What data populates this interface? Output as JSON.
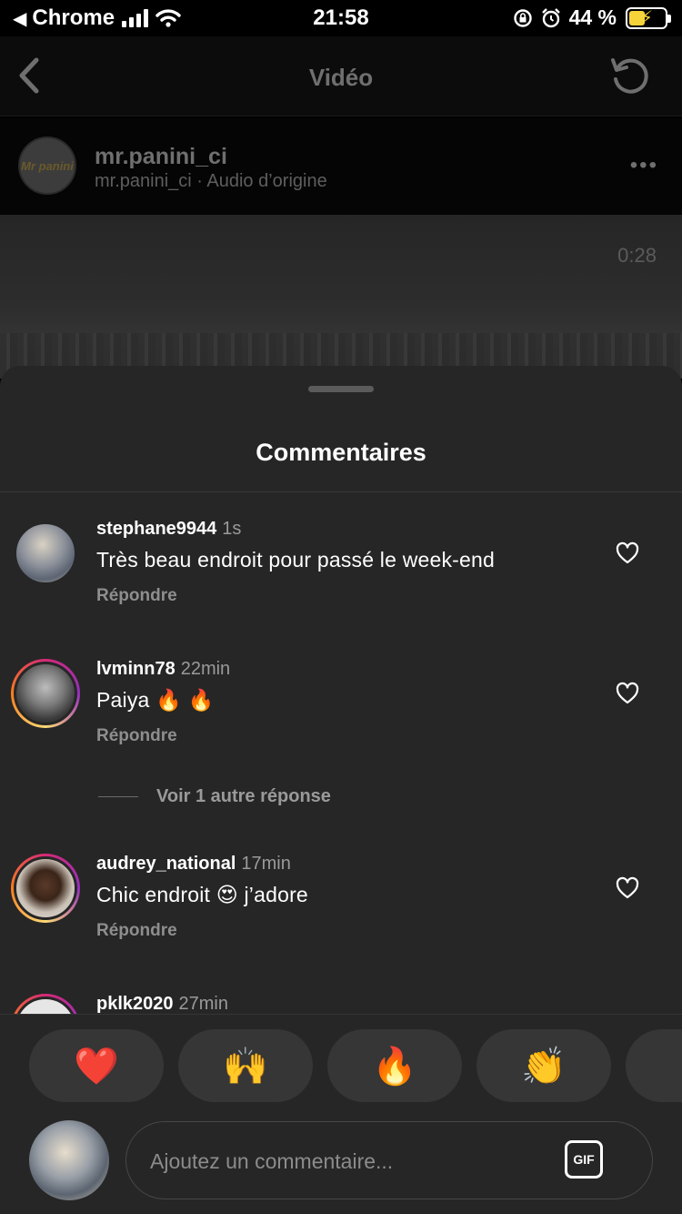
{
  "status_bar": {
    "back_app": "Chrome",
    "time": "21:58",
    "battery": "44 %"
  },
  "header": {
    "title": "Vidéo"
  },
  "post": {
    "username": "mr.panini_ci",
    "audio": "mr.panini_ci · Audio d’origine",
    "logo_text": "Mr panini",
    "video_duration": "0:28"
  },
  "comments_sheet": {
    "title": "Commentaires",
    "reply_label": "Répondre",
    "more_replies": "Voir 1 autre réponse",
    "items": [
      {
        "user": "stephane9944",
        "ago": "1s",
        "text": "Très beau endroit pour passé le week-end"
      },
      {
        "user": "lvminn78",
        "ago": "22min",
        "text": "Paiya 🔥 🔥"
      },
      {
        "user": "audrey_national",
        "ago": "17min",
        "text": "Chic endroit 😍 j’adore"
      },
      {
        "user": "pklk2020",
        "ago": "27min",
        "text": ""
      }
    ]
  },
  "reactions": [
    "❤️",
    "🙌",
    "🔥",
    "👏"
  ],
  "composer": {
    "placeholder": "Ajoutez un commentaire...",
    "gif_label": "GIF"
  }
}
